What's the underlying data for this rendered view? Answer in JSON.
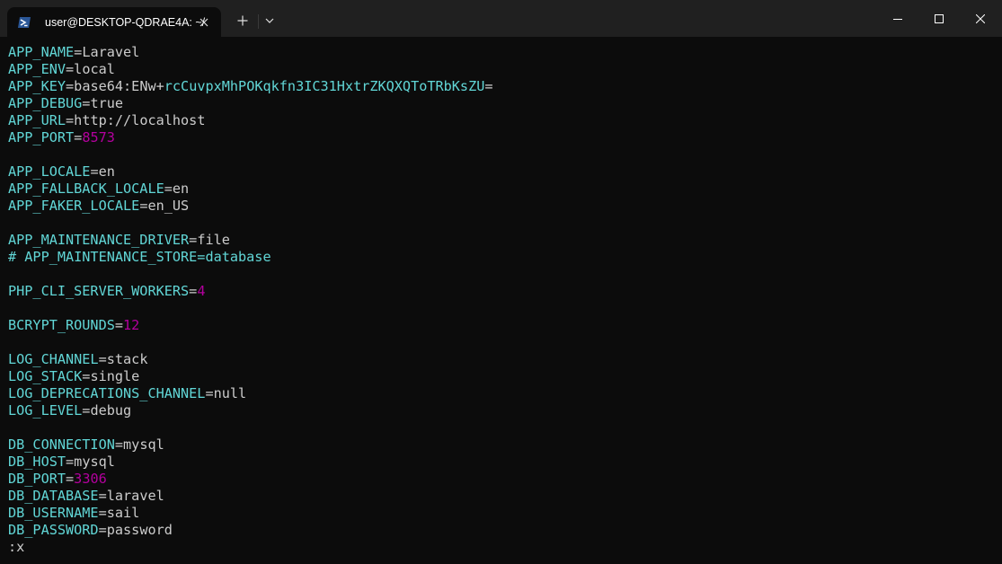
{
  "window": {
    "tab_title": "user@DESKTOP-QDRAE4A: ~/",
    "icons": {
      "tab": "powershell-icon",
      "tab_close": "close-icon",
      "new_tab": "plus-icon",
      "dropdown": "chevron-down-icon",
      "minimize": "minimize-icon",
      "maximize": "maximize-icon",
      "close": "close-icon"
    }
  },
  "colors": {
    "background": "#0c0c0c",
    "titlebar": "#202020",
    "key": "#61d6d6",
    "text": "#cccccc",
    "number": "#b4009e"
  },
  "terminal": {
    "lines": [
      {
        "key": "APP_NAME",
        "eq": "=",
        "val": "Laravel",
        "vt": "v"
      },
      {
        "key": "APP_ENV",
        "eq": "=",
        "val": "local",
        "vt": "v"
      },
      {
        "key": "APP_KEY",
        "eq": "=",
        "val": "base64:ENw+",
        "vt": "v",
        "val2": "rcCuvpxMhPOKqkfn3IC31HxtrZKQXQToTRbKsZU",
        "vt2": "h",
        "val3": "=",
        "vt3": "v"
      },
      {
        "key": "APP_DEBUG",
        "eq": "=",
        "val": "true",
        "vt": "v"
      },
      {
        "key": "APP_URL",
        "eq": "=",
        "val": "http://localhost",
        "vt": "v"
      },
      {
        "key": "APP_PORT",
        "eq": "=",
        "val": "8573",
        "vt": "n"
      },
      {
        "blank": true
      },
      {
        "key": "APP_LOCALE",
        "eq": "=",
        "val": "en",
        "vt": "v"
      },
      {
        "key": "APP_FALLBACK_LOCALE",
        "eq": "=",
        "val": "en",
        "vt": "v"
      },
      {
        "key": "APP_FAKER_LOCALE",
        "eq": "=",
        "val": "en_US",
        "vt": "v"
      },
      {
        "blank": true
      },
      {
        "key": "APP_MAINTENANCE_DRIVER",
        "eq": "=",
        "val": "file",
        "vt": "v"
      },
      {
        "key": "# APP_MAINTENANCE_STORE=database",
        "eq": "",
        "val": "",
        "vt": "v"
      },
      {
        "blank": true
      },
      {
        "key": "PHP_CLI_SERVER_WORKERS",
        "eq": "=",
        "val": "4",
        "vt": "n"
      },
      {
        "blank": true
      },
      {
        "key": "BCRYPT_ROUNDS",
        "eq": "=",
        "val": "12",
        "vt": "n"
      },
      {
        "blank": true
      },
      {
        "key": "LOG_CHANNEL",
        "eq": "=",
        "val": "stack",
        "vt": "v"
      },
      {
        "key": "LOG_STACK",
        "eq": "=",
        "val": "single",
        "vt": "v"
      },
      {
        "key": "LOG_DEPRECATIONS_CHANNEL",
        "eq": "=",
        "val": "null",
        "vt": "v"
      },
      {
        "key": "LOG_LEVEL",
        "eq": "=",
        "val": "debug",
        "vt": "v"
      },
      {
        "blank": true
      },
      {
        "key": "DB_CONNECTION",
        "eq": "=",
        "val": "mysql",
        "vt": "v"
      },
      {
        "key": "DB_HOST",
        "eq": "=",
        "val": "mysql",
        "vt": "v"
      },
      {
        "key": "DB_PORT",
        "eq": "=",
        "val": "3306",
        "vt": "n"
      },
      {
        "key": "DB_DATABASE",
        "eq": "=",
        "val": "laravel",
        "vt": "v"
      },
      {
        "key": "DB_USERNAME",
        "eq": "=",
        "val": "sail",
        "vt": "v"
      },
      {
        "key": "DB_PASSWORD",
        "eq": "=",
        "val": "password",
        "vt": "v"
      }
    ],
    "command_line": ":x"
  }
}
